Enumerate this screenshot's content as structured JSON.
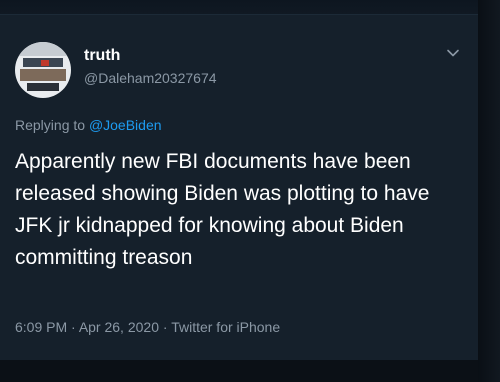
{
  "tweet": {
    "display_name": "truth",
    "handle": "@Daleham20327674",
    "replying_prefix": "Replying to ",
    "replying_to": "@JoeBiden",
    "text": "Apparently new FBI documents have been released showing Biden was plotting to have JFK jr kidnapped for knowing about Biden committing treason",
    "time": "6:09 PM",
    "separator": " · ",
    "date": "Apr 26, 2020",
    "source": "Twitter for iPhone",
    "menu_icon": "chevron-down-icon"
  },
  "colors": {
    "background": "#15202b",
    "text_primary": "#ffffff",
    "text_secondary": "#8b98a5",
    "accent": "#1d9bf0"
  }
}
